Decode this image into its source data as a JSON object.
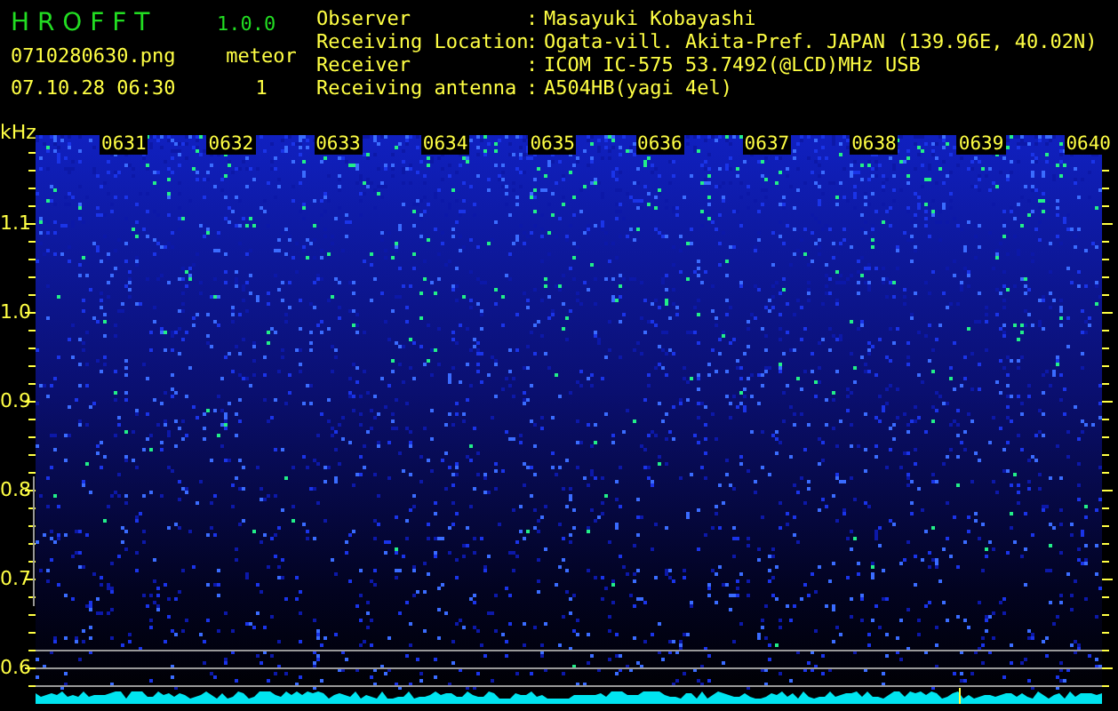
{
  "header": {
    "app_name": "H R O F F T",
    "version": "1.0.0",
    "file_name": "0710280630.png",
    "timestamp": "07.10.28 06:30",
    "count_label": "meteor",
    "count": "1"
  },
  "station_info": [
    {
      "label": "Observer",
      "separator": ":",
      "value": "Masayuki Kobayashi"
    },
    {
      "label": "Receiving Location",
      "separator": ":",
      "value": "Ogata-vill. Akita-Pref. JAPAN (139.96E, 40.02N)"
    },
    {
      "label": "Receiver",
      "separator": ":",
      "value": "ICOM IC-575 53.7492(@LCD)MHz USB"
    },
    {
      "label": "Receiving antenna",
      "separator": ":",
      "value": "A504HB(yagi 4el)"
    }
  ],
  "spectrogram": {
    "unit": "kHz",
    "y_ticks": [
      "1.1",
      "1.0",
      "0.9",
      "0.8",
      "0.7",
      "0.6"
    ],
    "time_marks": [
      "0631",
      "0632",
      "0633",
      "0634",
      "0635",
      "0636",
      "0637",
      "0638",
      "0639",
      "0640"
    ]
  }
}
